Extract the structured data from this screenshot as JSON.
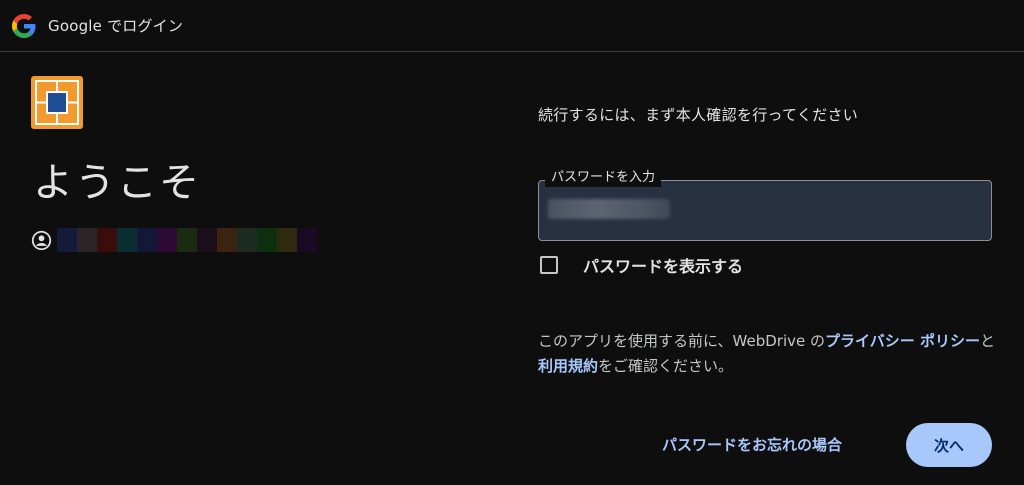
{
  "header": {
    "title": "Google でログイン",
    "logo_icon": "google-g-icon"
  },
  "app": {
    "logo_icon": "webdrive-logo-icon",
    "logo_colors": {
      "orange": "#f29a2e",
      "blue": "#1f4e96",
      "frame": "#ffffff"
    }
  },
  "welcome": {
    "heading": "ようこそ",
    "account_icon": "account-circle-icon"
  },
  "form": {
    "prompt": "続行するには、まず本人確認を行ってください",
    "password_label": "パスワードを入力",
    "password_value": "••••••••••",
    "show_password_label": "パスワードを表示する",
    "show_password_checked": false
  },
  "notice": {
    "text_before": "このアプリを使用する前に、WebDrive の",
    "privacy_link": "プライバシー ポリシー",
    "text_middle": "と",
    "terms_link": "利用規約",
    "text_after": "をご確認ください。"
  },
  "actions": {
    "forgot_password": "パスワードをお忘れの場合",
    "next": "次へ"
  },
  "colors": {
    "background": "#0e0e0f",
    "text": "#e3e3e3",
    "link": "#a8c7fa",
    "primary_button": "#a8c7fa",
    "input_fill": "#283142"
  }
}
